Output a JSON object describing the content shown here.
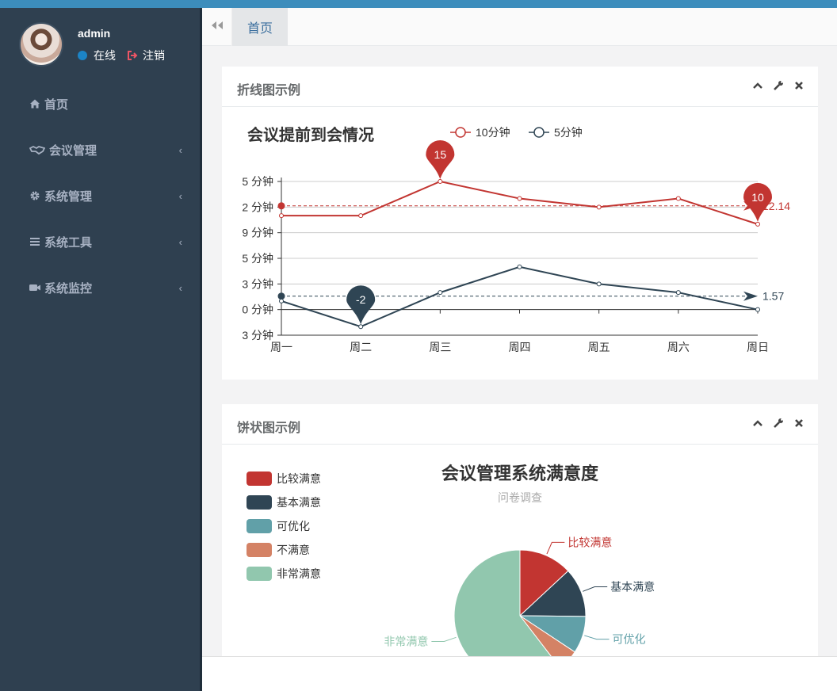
{
  "user": {
    "name": "admin",
    "status": "在线",
    "logout": "注销"
  },
  "menu": [
    {
      "label": "首页",
      "icon": "home-icon",
      "has_arrow": false
    },
    {
      "label": "会议管理",
      "icon": "handshake-icon",
      "has_arrow": true
    },
    {
      "label": "系统管理",
      "icon": "gear-icon",
      "has_arrow": true
    },
    {
      "label": "系统工具",
      "icon": "bars-icon",
      "has_arrow": true
    },
    {
      "label": "系统监控",
      "icon": "video-camera-icon",
      "has_arrow": true
    }
  ],
  "menu_arrow": "‹",
  "tabs": {
    "home": "首页"
  },
  "panels": {
    "line": {
      "title": "折线图示例"
    },
    "pie": {
      "title": "饼状图示例"
    }
  },
  "chart_data": [
    {
      "type": "line",
      "title": "会议提前到会情况",
      "categories": [
        "周一",
        "周二",
        "周三",
        "周四",
        "周五",
        "周六",
        "周日"
      ],
      "y_tick_labels": [
        "5 分钟",
        "2 分钟",
        "9 分钟",
        "5 分钟",
        "3 分钟",
        "0 分钟",
        "3 分钟"
      ],
      "ylim": [
        -3,
        15
      ],
      "series": [
        {
          "name": "10分钟",
          "color": "#c23531",
          "values": [
            11,
            11,
            15,
            13,
            12,
            13,
            10
          ],
          "max_label": "15",
          "min_label": "10",
          "average_label": "12.14"
        },
        {
          "name": "5分钟",
          "color": "#2f4554",
          "values": [
            1,
            -2,
            2,
            5,
            3,
            2,
            0
          ],
          "min_label": "-2",
          "average_label": "1.57"
        }
      ],
      "grid": true,
      "legend_position": "top"
    },
    {
      "type": "pie",
      "title": "会议管理系统满意度",
      "subtitle": "问卷调查",
      "legend_position": "left",
      "slices": [
        {
          "name": "比较满意",
          "value": 335,
          "color": "#c23531"
        },
        {
          "name": "基本满意",
          "value": 310,
          "color": "#2f4554"
        },
        {
          "name": "可优化",
          "value": 234,
          "color": "#61a0a8"
        },
        {
          "name": "不满意",
          "value": 135,
          "color": "#d48265"
        },
        {
          "name": "非常满意",
          "value": 1548,
          "color": "#91c7ae"
        }
      ]
    }
  ]
}
